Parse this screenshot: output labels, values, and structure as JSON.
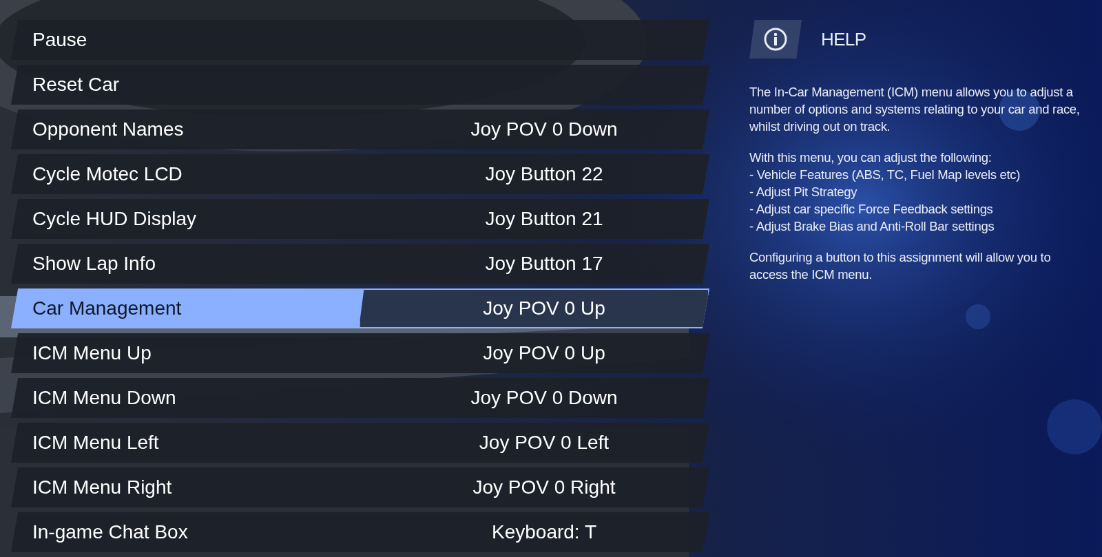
{
  "bindings": [
    {
      "action": "Pause",
      "selected": false
    },
    {
      "action": "Reset Car",
      "selected": false
    },
    {
      "action": "Opponent Names",
      "binding": "Joy POV 0 Down",
      "selected": false
    },
    {
      "action": "Cycle Motec LCD",
      "binding": "Joy Button 22",
      "selected": false
    },
    {
      "action": "Cycle HUD Display",
      "binding": "Joy Button 21",
      "selected": false
    },
    {
      "action": "Show Lap Info",
      "binding": "Joy Button 17",
      "selected": false
    },
    {
      "action": "Car Management",
      "binding": "Joy POV 0 Up",
      "selected": true
    },
    {
      "action": "ICM Menu Up",
      "binding": "Joy POV 0 Up",
      "selected": false
    },
    {
      "action": "ICM Menu Down",
      "binding": "Joy POV 0 Down",
      "selected": false
    },
    {
      "action": "ICM Menu Left",
      "binding": "Joy POV 0 Left",
      "selected": false
    },
    {
      "action": "ICM Menu Right",
      "binding": "Joy POV 0 Right",
      "selected": false
    },
    {
      "action": "In-game Chat Box",
      "binding": "Keyboard: T",
      "selected": false
    }
  ],
  "help": {
    "title": "HELP",
    "paragraphs": [
      "The In-Car Management (ICM) menu allows you to adjust a number of options and systems relating to your car and race, whilst driving out on track.",
      "With this menu, you can adjust the following:\n- Vehicle Features (ABS, TC, Fuel Map levels etc)\n- Adjust Pit Strategy\n- Adjust car specific Force Feedback settings\n- Adjust Brake Bias and Anti-Roll Bar settings",
      "Configuring a button to this assignment will allow you to access the ICM menu."
    ]
  }
}
